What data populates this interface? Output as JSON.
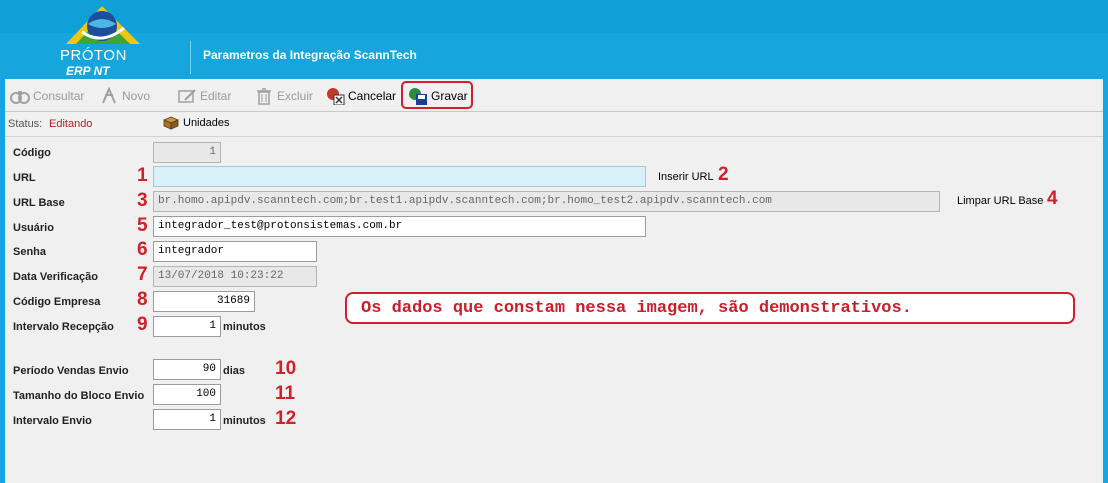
{
  "header": {
    "logo_line1": "PRÓTON",
    "logo_line2": "ERP NT",
    "title": "Parametros da Integração ScannTech"
  },
  "toolbar": {
    "buttons": [
      {
        "label": "Consultar",
        "icon": "binoculars-icon",
        "enabled": false
      },
      {
        "label": "Novo",
        "icon": "new-document-icon",
        "enabled": false
      },
      {
        "label": "Editar",
        "icon": "edit-icon",
        "enabled": false
      },
      {
        "label": "Excluir",
        "icon": "trash-icon",
        "enabled": false
      },
      {
        "label": "Cancelar",
        "icon": "cancel-icon",
        "enabled": true
      },
      {
        "label": "Gravar",
        "icon": "save-icon",
        "enabled": true
      }
    ]
  },
  "status": {
    "label": "Status:",
    "value": "Editando",
    "unidades_label": "Unidades"
  },
  "form": {
    "codigo": {
      "label": "Código",
      "value": "1"
    },
    "url": {
      "label": "URL",
      "value": "",
      "action_label": "Inserir URL"
    },
    "url_base": {
      "label": "URL Base",
      "value": "br.homo.apipdv.scanntech.com;br.test1.apipdv.scanntech.com;br.homo_test2.apipdv.scanntech.com",
      "action_label": "Limpar URL Base"
    },
    "usuario": {
      "label": "Usuário",
      "value": "integrador_test@protonsistemas.com.br"
    },
    "senha": {
      "label": "Senha",
      "value": "integrador"
    },
    "data_verificacao": {
      "label": "Data Verificação",
      "value": "13/07/2018 10:23:22"
    },
    "codigo_empresa": {
      "label": "Código Empresa",
      "value": "31689"
    },
    "intervalo_recepcao": {
      "label": "Intervalo Recepção",
      "value": "1",
      "unit": "minutos"
    },
    "periodo_vendas_envio": {
      "label": "Período Vendas Envio",
      "value": "90",
      "unit": "dias"
    },
    "tamanho_bloco_envio": {
      "label": "Tamanho do Bloco Envio",
      "value": "100"
    },
    "intervalo_envio": {
      "label": "Intervalo Envio",
      "value": "1",
      "unit": "minutos"
    }
  },
  "annotations": {
    "markers": [
      "1",
      "2",
      "3",
      "4",
      "5",
      "6",
      "7",
      "8",
      "9",
      "10",
      "11",
      "12"
    ],
    "notice": "Os dados que constam nessa imagem, são demonstrativos.",
    "color": "#d0202a"
  },
  "colors": {
    "header_blue": "#14a6dd",
    "status_value": "#b22222",
    "url_field_bg": "#d8f1f8"
  }
}
